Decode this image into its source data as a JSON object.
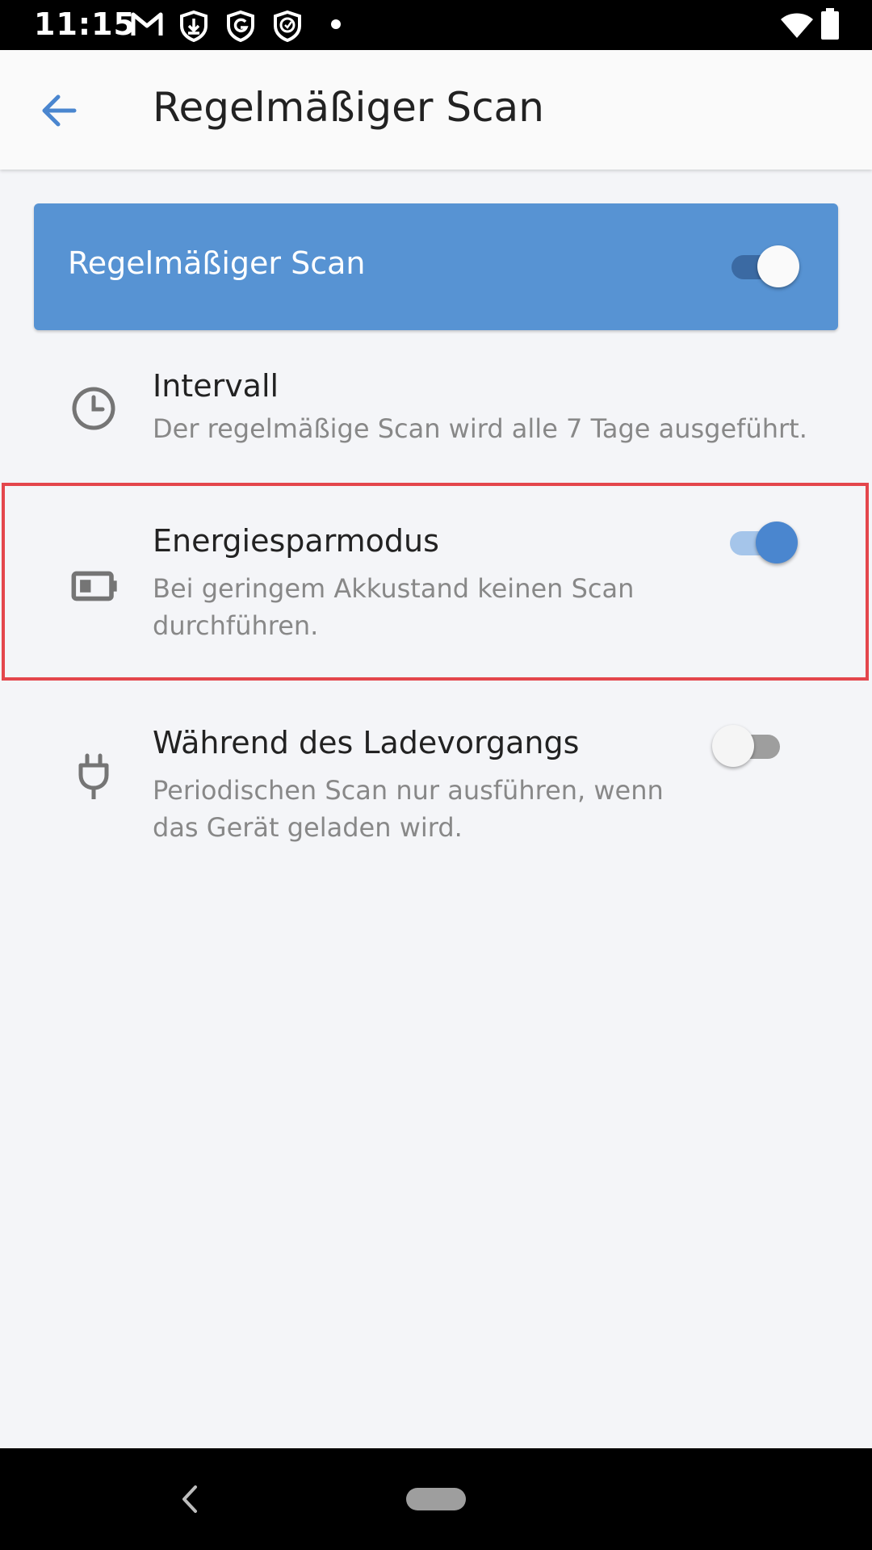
{
  "status_bar": {
    "time": "11:15",
    "left_icons": [
      "gmail-icon",
      "shield-download-icon",
      "shield-g-icon",
      "shield-check-icon",
      "dot-icon"
    ],
    "right_icons": [
      "wifi-icon",
      "battery-icon"
    ]
  },
  "app_bar": {
    "back_icon": "arrow-back-icon",
    "title": "Regelmäßiger Scan"
  },
  "master_toggle": {
    "label": "Regelmäßiger Scan",
    "checked": true
  },
  "settings": [
    {
      "icon": "clock-icon",
      "title": "Intervall",
      "subtitle": "Der regelmäßige Scan wird alle 7 Tage ausgeführt."
    },
    {
      "icon": "battery-low-icon",
      "title": "Energiesparmodus",
      "subtitle": "Bei geringem Akkustand keinen Scan durchführen.",
      "checked": true
    },
    {
      "icon": "plug-icon",
      "title": "Während des Ladevorgangs",
      "subtitle": "Periodischen Scan nur ausführen, wenn das Gerät geladen wird.",
      "checked": false
    }
  ],
  "colors": {
    "accent": "#5793d3",
    "highlight_border": "#e4464c",
    "background": "#f4f5f8"
  },
  "nav_bar": {
    "back_icon": "nav-back-icon",
    "home_icon": "nav-home-pill-icon"
  }
}
